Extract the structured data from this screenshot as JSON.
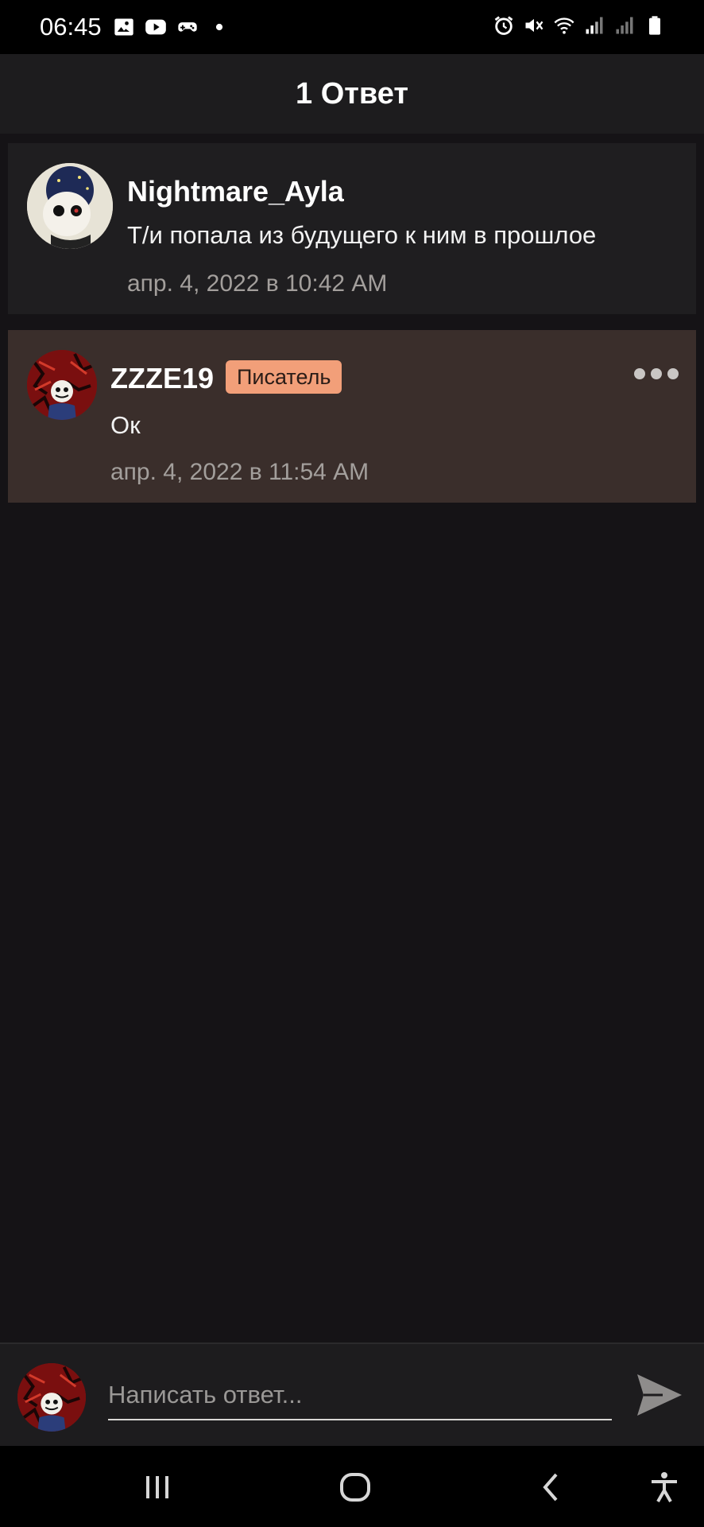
{
  "status_bar": {
    "time": "06:45",
    "left_icons": [
      "image-icon",
      "youtube-icon",
      "gamepad-icon",
      "dot-icon"
    ],
    "right_icons": [
      "alarm-icon",
      "mute-icon",
      "wifi-icon",
      "signal-icon",
      "signal2-icon",
      "battery-icon"
    ]
  },
  "header": {
    "title": "1 Ответ"
  },
  "comments": [
    {
      "username": "Nightmare_Ayla",
      "text": "Т/и попала из будущего к ним в прошлое",
      "date": "апр. 4, 2022 в 10:42 AM"
    },
    {
      "username": "ZZZE19",
      "badge": "Писатель",
      "text": "Ок",
      "date": "апр. 4, 2022 в 11:54 AM"
    }
  ],
  "reply": {
    "placeholder": "Написать ответ..."
  },
  "colors": {
    "background": "#151316",
    "highlight_comment": "#3a2e2b",
    "badge": "#f29f79"
  },
  "nav": [
    "recent-apps-icon",
    "home-icon",
    "back-icon",
    "accessibility-icon"
  ]
}
